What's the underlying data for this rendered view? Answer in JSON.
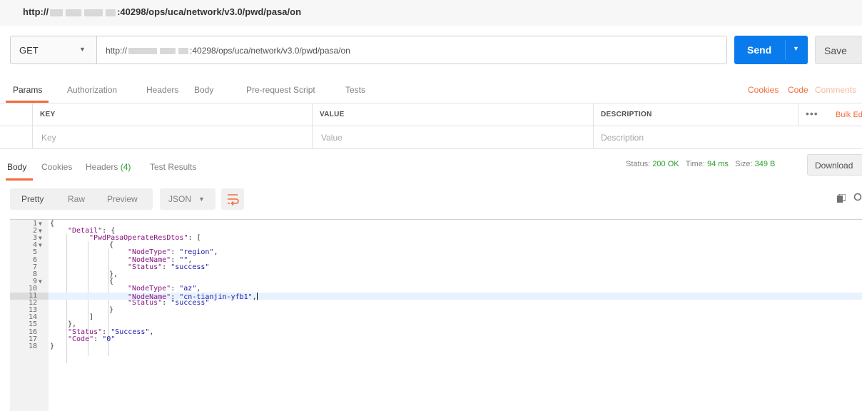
{
  "title_bar": {
    "prefix": "http://",
    "suffix": ":40298/ops/uca/network/v3.0/pwd/pasa/on"
  },
  "request": {
    "method": "GET",
    "url_prefix": "http://",
    "url_suffix": ":40298/ops/uca/network/v3.0/pwd/pasa/on",
    "send_label": "Send",
    "save_label": "Save"
  },
  "request_tabs": [
    "Params",
    "Authorization",
    "Headers",
    "Body",
    "Pre-request Script",
    "Tests"
  ],
  "request_links": {
    "cookies": "Cookies",
    "code": "Code",
    "comments": "Comments"
  },
  "params_table": {
    "headers": {
      "key": "KEY",
      "value": "VALUE",
      "description": "DESCRIPTION"
    },
    "placeholders": {
      "key": "Key",
      "value": "Value",
      "description": "Description"
    },
    "bulk_edit": "Bulk Edit",
    "more": "•••"
  },
  "response_tabs": {
    "body": "Body",
    "cookies": "Cookies",
    "headers": "Headers",
    "headers_count": "(4)",
    "tests": "Test Results"
  },
  "response_status": {
    "status_label": "Status:",
    "status_value": "200 OK",
    "time_label": "Time:",
    "time_value": "94 ms",
    "size_label": "Size:",
    "size_value": "349 B",
    "download_label": "Download"
  },
  "view_options": {
    "pretty": "Pretty",
    "raw": "Raw",
    "preview": "Preview",
    "format": "JSON"
  },
  "code_lines": [
    {
      "num": "1",
      "fold": true
    },
    {
      "num": "2",
      "fold": true
    },
    {
      "num": "3",
      "fold": true
    },
    {
      "num": "4",
      "fold": true
    },
    {
      "num": "5",
      "fold": false
    },
    {
      "num": "6",
      "fold": false
    },
    {
      "num": "7",
      "fold": false
    },
    {
      "num": "8",
      "fold": false
    },
    {
      "num": "9",
      "fold": true
    },
    {
      "num": "10",
      "fold": false
    },
    {
      "num": "11",
      "fold": false
    },
    {
      "num": "12",
      "fold": false
    },
    {
      "num": "13",
      "fold": false
    },
    {
      "num": "14",
      "fold": false
    },
    {
      "num": "15",
      "fold": false
    },
    {
      "num": "16",
      "fold": false
    },
    {
      "num": "17",
      "fold": false
    },
    {
      "num": "18",
      "fold": false
    }
  ],
  "code": {
    "l1": "{",
    "l2_key": "\"Detail\"",
    "l2_rest": ": {",
    "l3_key": "\"PwdPasaOperateResDtos\"",
    "l3_rest": ": [",
    "l4": "{",
    "l5_key": "\"NodeType\"",
    "l5_val": "\"region\"",
    "l6_key": "\"NodeName\"",
    "l6_val": "\"\"",
    "l7_key": "\"Status\"",
    "l7_val": "\"success\"",
    "l8": "},",
    "l9": "{",
    "l10_key": "\"NodeType\"",
    "l10_val": "\"az\"",
    "l11_key": "\"NodeName\"",
    "l11_val": "\"cn-tianjin-yfb1\"",
    "l12_key": "\"Status\"",
    "l12_val": "\"success\"",
    "l13": "}",
    "l14": "]",
    "l15": "},",
    "l16_key": "\"Status\"",
    "l16_val": "\"Success\"",
    "l17_key": "\"Code\"",
    "l17_val": "\"0\"",
    "l18": "}"
  },
  "colors": {
    "accent": "#f26b3a",
    "send": "#097bed",
    "ok": "#2c9e2c",
    "json_key": "#881280",
    "json_string": "#1a1aa6"
  },
  "icons": [
    "chevron-down-icon",
    "wrap-lines-icon",
    "copy-icon",
    "search-icon"
  ]
}
